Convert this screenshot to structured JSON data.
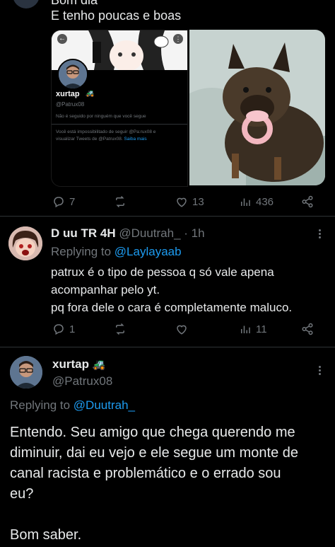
{
  "tweet1": {
    "header_cut": "Bom dia",
    "text": "E tenho poucas e boas",
    "embed": {
      "name": "xurtap",
      "handle": "@Patrux08",
      "follow_note": "Não é seguido por ninguém que você segue",
      "blocked_note_1": "Você está impossibilitado de seguir @Pa:rux08 e",
      "blocked_note_2": "visualizar Tweets de @Patrux08.",
      "learn_more": "Saiba mais"
    },
    "stats": {
      "replies": "7",
      "likes": "13",
      "views": "436"
    }
  },
  "tweet2": {
    "name": "D uu TR 4H",
    "handle": "@Duutrah_",
    "time": "· 1h",
    "replying_label": "Replying to",
    "replying_to": "@Laylayaab",
    "lines": [
      "patrux é o tipo de pessoa q só vale apena",
      "acompanhar pelo yt.",
      "pq fora dele o cara é completamente maluco."
    ],
    "stats": {
      "replies": "1",
      "views": "11"
    }
  },
  "tweet3": {
    "name": "xurtap",
    "handle": "@Patrux08",
    "replying_label": "Replying to",
    "replying_to": "@Duutrah_",
    "lines": [
      "Entendo. Seu amigo que chega querendo me",
      "diminuir, dai eu vejo e ele segue um monte de",
      "canal racista e problemático e o errado sou",
      "eu?",
      "",
      "Bom saber."
    ]
  },
  "colors": {
    "bg": "#000000",
    "text": "#e7e9ea",
    "muted": "#71767b",
    "link": "#1d9bf0"
  }
}
